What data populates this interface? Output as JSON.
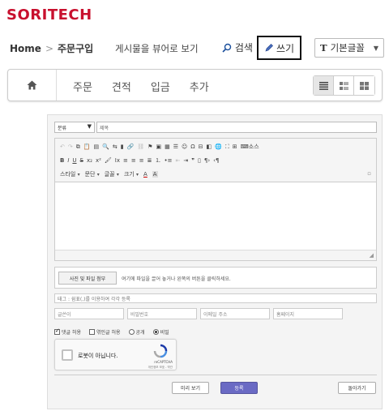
{
  "logo": {
    "text": "SORITECH",
    "color": "#c8102e"
  },
  "breadcrumb": {
    "home": "Home",
    "current": "주문구입"
  },
  "header": {
    "board_view": "게시물을 뷰어로 보기",
    "search": "검색",
    "write": "쓰기",
    "font": "기본글꼴",
    "font_icon": "T"
  },
  "nav": {
    "tabs": [
      "주문",
      "견적",
      "입금",
      "추가"
    ],
    "view_modes": [
      "list-view-icon",
      "detail-view-icon",
      "grid-view-icon"
    ],
    "active_view": "list-view-icon"
  },
  "form": {
    "category_select": "분류",
    "title_placeholder": "제목",
    "toolbar": {
      "row1_end": "소스",
      "row3": {
        "style": "스타일",
        "format": "문단",
        "font": "글꼴",
        "size": "크기"
      }
    },
    "upload": {
      "button": "사진 및 파일 첨부",
      "hint": "여기에 파일을 끌어 놓거나 왼쪽의 버튼을 클릭하세요."
    },
    "tag_placeholder": "태그 : 쉼표(,)를 이용하여 각각 등록",
    "author_placeholder": "글쓴이",
    "password_placeholder": "비밀번호",
    "email_placeholder": "이메일 주소",
    "homepage_placeholder": "홈페이지",
    "options": {
      "allow_comments": "댓글 허용",
      "allow_trackback": "엮인글 허용",
      "public": "공개",
      "secret": "비밀"
    },
    "captcha": {
      "label": "로봇이 아닙니다.",
      "brand": "reCAPTCHA",
      "terms": "개인정보 보호 - 약관"
    },
    "buttons": {
      "preview": "미리 보기",
      "submit": "등록",
      "back": "돌아가기"
    },
    "colors": {
      "primary": "#6a6ac4"
    }
  }
}
